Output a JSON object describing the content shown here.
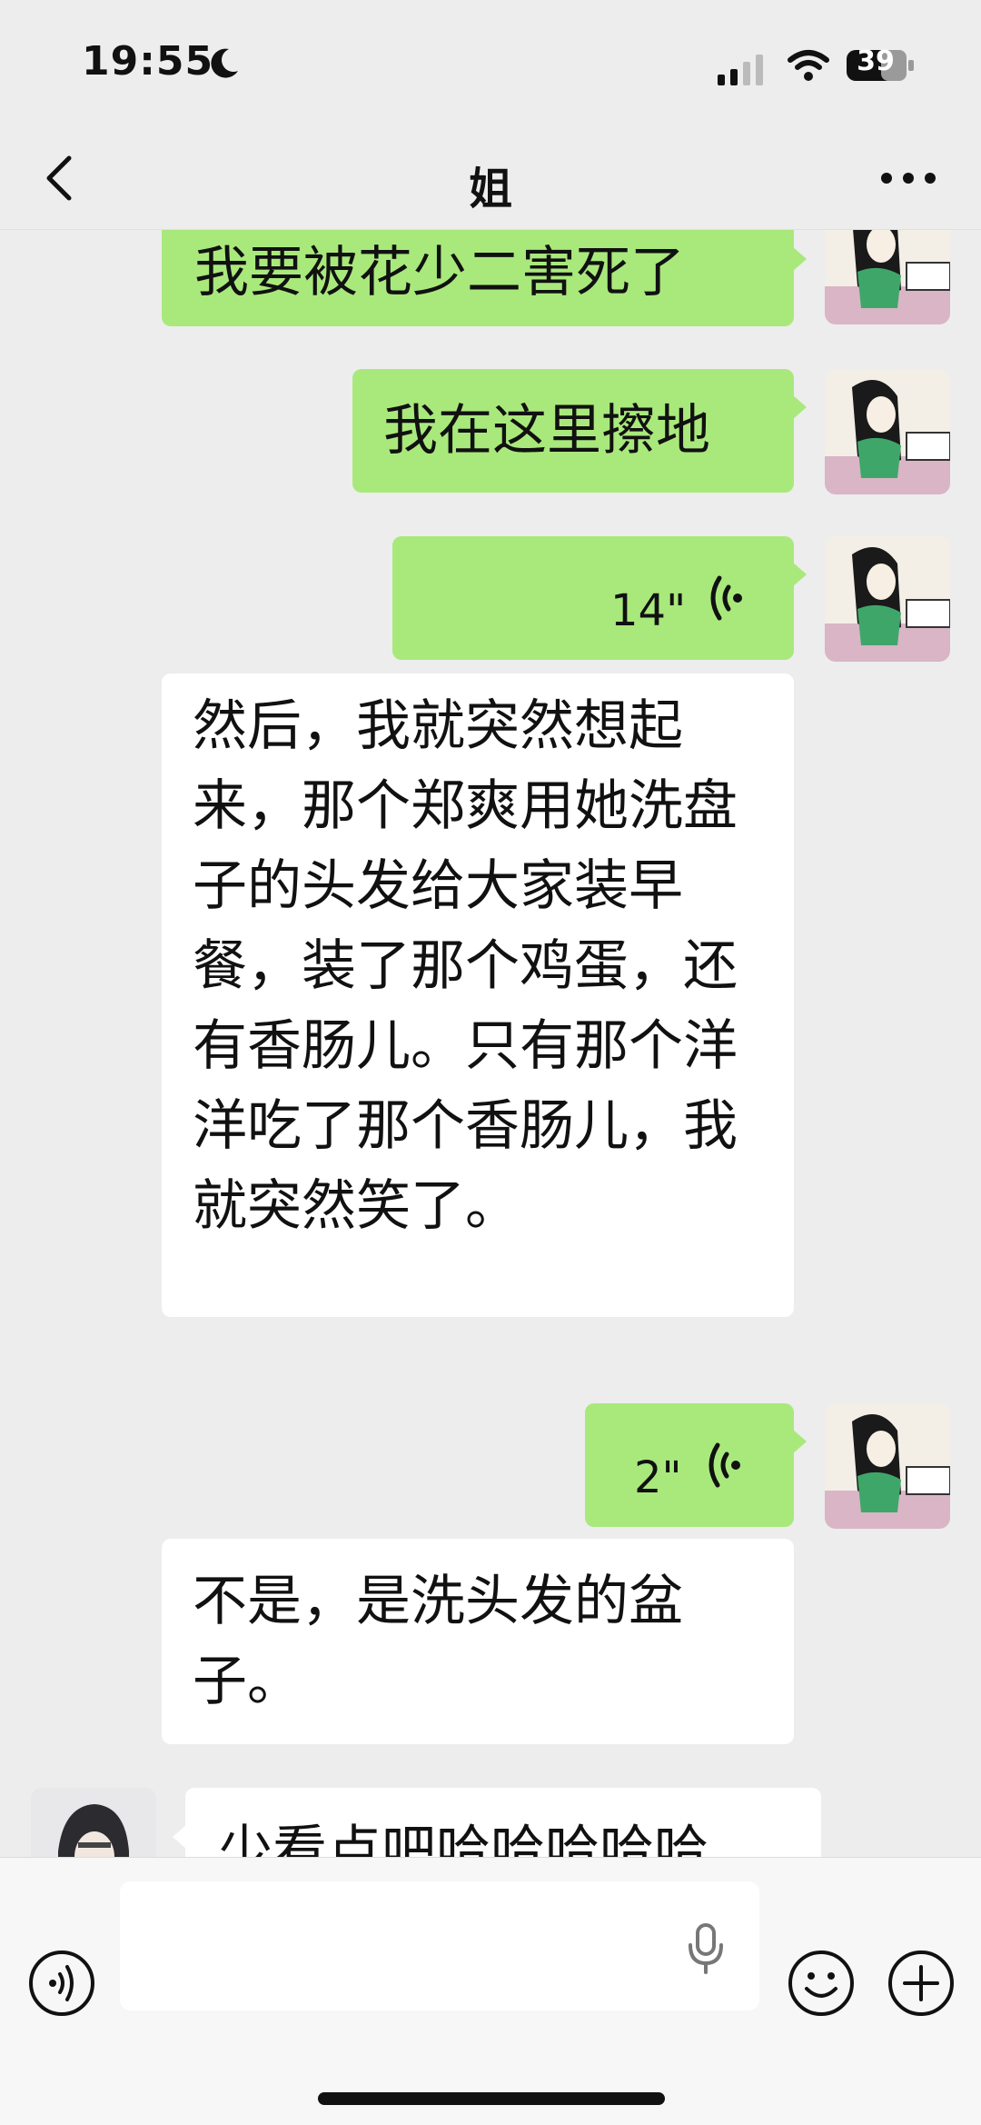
{
  "status_bar": {
    "time": "19:55",
    "battery": "39",
    "icons": [
      "moon-icon",
      "cellular-signal-icon",
      "wifi-icon",
      "battery-icon"
    ]
  },
  "nav": {
    "title": "姐",
    "icons": [
      "back-chevron-icon",
      "more-dots-icon"
    ]
  },
  "messages": [
    {
      "sender": "me",
      "type": "text",
      "text": "我要被花少二害死了"
    },
    {
      "sender": "me",
      "type": "text",
      "text": "我在这里擦地"
    },
    {
      "sender": "me",
      "type": "voice",
      "duration": "14\""
    },
    {
      "sender": "other",
      "type": "text",
      "text": "然后，我就突然想起来，那个郑爽用她洗盘子的头发给大家装早餐，装了那个鸡蛋，还有香肠儿。只有那个洋洋吃了那个香肠儿，我就突然笑了。"
    },
    {
      "sender": "me",
      "type": "voice",
      "duration": "2\""
    },
    {
      "sender": "other",
      "type": "text",
      "text": "不是，是洗头发的盆子。"
    },
    {
      "sender": "contact",
      "type": "text",
      "text": "少看点吧哈哈哈哈哈"
    }
  ],
  "input_bar": {
    "icons": [
      "voice-toggle-icon",
      "microphone-icon",
      "emoji-icon",
      "plus-icon"
    ]
  },
  "colors": {
    "background": "#ededed",
    "my_bubble": "#a9e97c",
    "other_bubble": "#ffffff"
  }
}
